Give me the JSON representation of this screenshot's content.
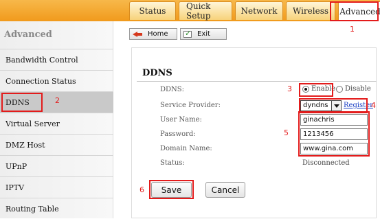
{
  "tabs": [
    {
      "label": "Status"
    },
    {
      "label": "Quick Setup"
    },
    {
      "label": "Network"
    },
    {
      "label": "Wireless"
    },
    {
      "label": "Advanced",
      "active": true
    }
  ],
  "toolbar": {
    "home_label": "Home",
    "exit_label": "Exit"
  },
  "sidebar": {
    "title": "Advanced",
    "items": [
      {
        "label": "Bandwidth Control"
      },
      {
        "label": "Connection Status"
      },
      {
        "label": "DDNS",
        "active": true
      },
      {
        "label": "Virtual Server"
      },
      {
        "label": "DMZ Host"
      },
      {
        "label": "UPnP"
      },
      {
        "label": "IPTV"
      },
      {
        "label": "Routing Table"
      }
    ]
  },
  "ddns": {
    "title": "DDNS",
    "ddns_label": "DDNS:",
    "enable_label": "Enable",
    "disable_label": "Disable",
    "enabled": true,
    "provider_label": "Service Provider:",
    "provider_value": "dyndns",
    "register_label": "Register",
    "username_label": "User Name:",
    "username_value": "ginachris",
    "password_label": "Password:",
    "password_value": "1213456",
    "domain_label": "Domain Name:",
    "domain_value": "www.gina.com",
    "status_label": "Status:",
    "status_value": "Disconnected"
  },
  "actions": {
    "save_label": "Save",
    "cancel_label": "Cancel"
  },
  "annotations": {
    "m1": "1",
    "m2": "2",
    "m3": "3",
    "m4": "4",
    "m5": "5",
    "m6": "6"
  },
  "colors": {
    "accent_orange": "#f19a1c",
    "highlight_red": "#e31b1b",
    "link_blue": "#1a3fc4"
  }
}
